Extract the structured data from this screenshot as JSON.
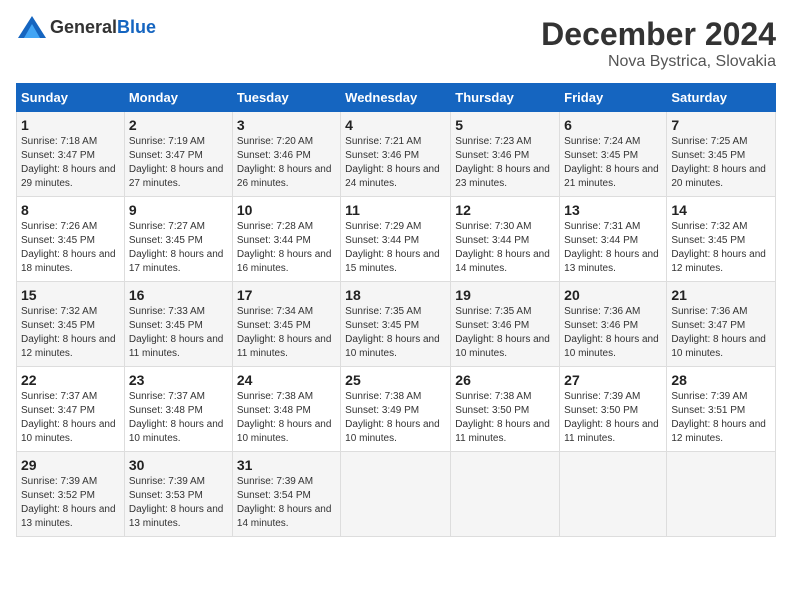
{
  "header": {
    "logo_general": "General",
    "logo_blue": "Blue",
    "title": "December 2024",
    "subtitle": "Nova Bystrica, Slovakia"
  },
  "calendar": {
    "columns": [
      "Sunday",
      "Monday",
      "Tuesday",
      "Wednesday",
      "Thursday",
      "Friday",
      "Saturday"
    ],
    "weeks": [
      [
        null,
        null,
        null,
        null,
        null,
        null,
        null
      ]
    ],
    "days": [
      {
        "date": "1",
        "sunrise": "7:18 AM",
        "sunset": "3:47 PM",
        "daylight": "8 hours and 29 minutes."
      },
      {
        "date": "2",
        "sunrise": "7:19 AM",
        "sunset": "3:47 PM",
        "daylight": "8 hours and 27 minutes."
      },
      {
        "date": "3",
        "sunrise": "7:20 AM",
        "sunset": "3:46 PM",
        "daylight": "8 hours and 26 minutes."
      },
      {
        "date": "4",
        "sunrise": "7:21 AM",
        "sunset": "3:46 PM",
        "daylight": "8 hours and 24 minutes."
      },
      {
        "date": "5",
        "sunrise": "7:23 AM",
        "sunset": "3:46 PM",
        "daylight": "8 hours and 23 minutes."
      },
      {
        "date": "6",
        "sunrise": "7:24 AM",
        "sunset": "3:45 PM",
        "daylight": "8 hours and 21 minutes."
      },
      {
        "date": "7",
        "sunrise": "7:25 AM",
        "sunset": "3:45 PM",
        "daylight": "8 hours and 20 minutes."
      },
      {
        "date": "8",
        "sunrise": "7:26 AM",
        "sunset": "3:45 PM",
        "daylight": "8 hours and 18 minutes."
      },
      {
        "date": "9",
        "sunrise": "7:27 AM",
        "sunset": "3:45 PM",
        "daylight": "8 hours and 17 minutes."
      },
      {
        "date": "10",
        "sunrise": "7:28 AM",
        "sunset": "3:44 PM",
        "daylight": "8 hours and 16 minutes."
      },
      {
        "date": "11",
        "sunrise": "7:29 AM",
        "sunset": "3:44 PM",
        "daylight": "8 hours and 15 minutes."
      },
      {
        "date": "12",
        "sunrise": "7:30 AM",
        "sunset": "3:44 PM",
        "daylight": "8 hours and 14 minutes."
      },
      {
        "date": "13",
        "sunrise": "7:31 AM",
        "sunset": "3:44 PM",
        "daylight": "8 hours and 13 minutes."
      },
      {
        "date": "14",
        "sunrise": "7:32 AM",
        "sunset": "3:45 PM",
        "daylight": "8 hours and 12 minutes."
      },
      {
        "date": "15",
        "sunrise": "7:32 AM",
        "sunset": "3:45 PM",
        "daylight": "8 hours and 12 minutes."
      },
      {
        "date": "16",
        "sunrise": "7:33 AM",
        "sunset": "3:45 PM",
        "daylight": "8 hours and 11 minutes."
      },
      {
        "date": "17",
        "sunrise": "7:34 AM",
        "sunset": "3:45 PM",
        "daylight": "8 hours and 11 minutes."
      },
      {
        "date": "18",
        "sunrise": "7:35 AM",
        "sunset": "3:45 PM",
        "daylight": "8 hours and 10 minutes."
      },
      {
        "date": "19",
        "sunrise": "7:35 AM",
        "sunset": "3:46 PM",
        "daylight": "8 hours and 10 minutes."
      },
      {
        "date": "20",
        "sunrise": "7:36 AM",
        "sunset": "3:46 PM",
        "daylight": "8 hours and 10 minutes."
      },
      {
        "date": "21",
        "sunrise": "7:36 AM",
        "sunset": "3:47 PM",
        "daylight": "8 hours and 10 minutes."
      },
      {
        "date": "22",
        "sunrise": "7:37 AM",
        "sunset": "3:47 PM",
        "daylight": "8 hours and 10 minutes."
      },
      {
        "date": "23",
        "sunrise": "7:37 AM",
        "sunset": "3:48 PM",
        "daylight": "8 hours and 10 minutes."
      },
      {
        "date": "24",
        "sunrise": "7:38 AM",
        "sunset": "3:48 PM",
        "daylight": "8 hours and 10 minutes."
      },
      {
        "date": "25",
        "sunrise": "7:38 AM",
        "sunset": "3:49 PM",
        "daylight": "8 hours and 10 minutes."
      },
      {
        "date": "26",
        "sunrise": "7:38 AM",
        "sunset": "3:50 PM",
        "daylight": "8 hours and 11 minutes."
      },
      {
        "date": "27",
        "sunrise": "7:39 AM",
        "sunset": "3:50 PM",
        "daylight": "8 hours and 11 minutes."
      },
      {
        "date": "28",
        "sunrise": "7:39 AM",
        "sunset": "3:51 PM",
        "daylight": "8 hours and 12 minutes."
      },
      {
        "date": "29",
        "sunrise": "7:39 AM",
        "sunset": "3:52 PM",
        "daylight": "8 hours and 13 minutes."
      },
      {
        "date": "30",
        "sunrise": "7:39 AM",
        "sunset": "3:53 PM",
        "daylight": "8 hours and 13 minutes."
      },
      {
        "date": "31",
        "sunrise": "7:39 AM",
        "sunset": "3:54 PM",
        "daylight": "8 hours and 14 minutes."
      }
    ],
    "start_day_of_week": 0
  }
}
